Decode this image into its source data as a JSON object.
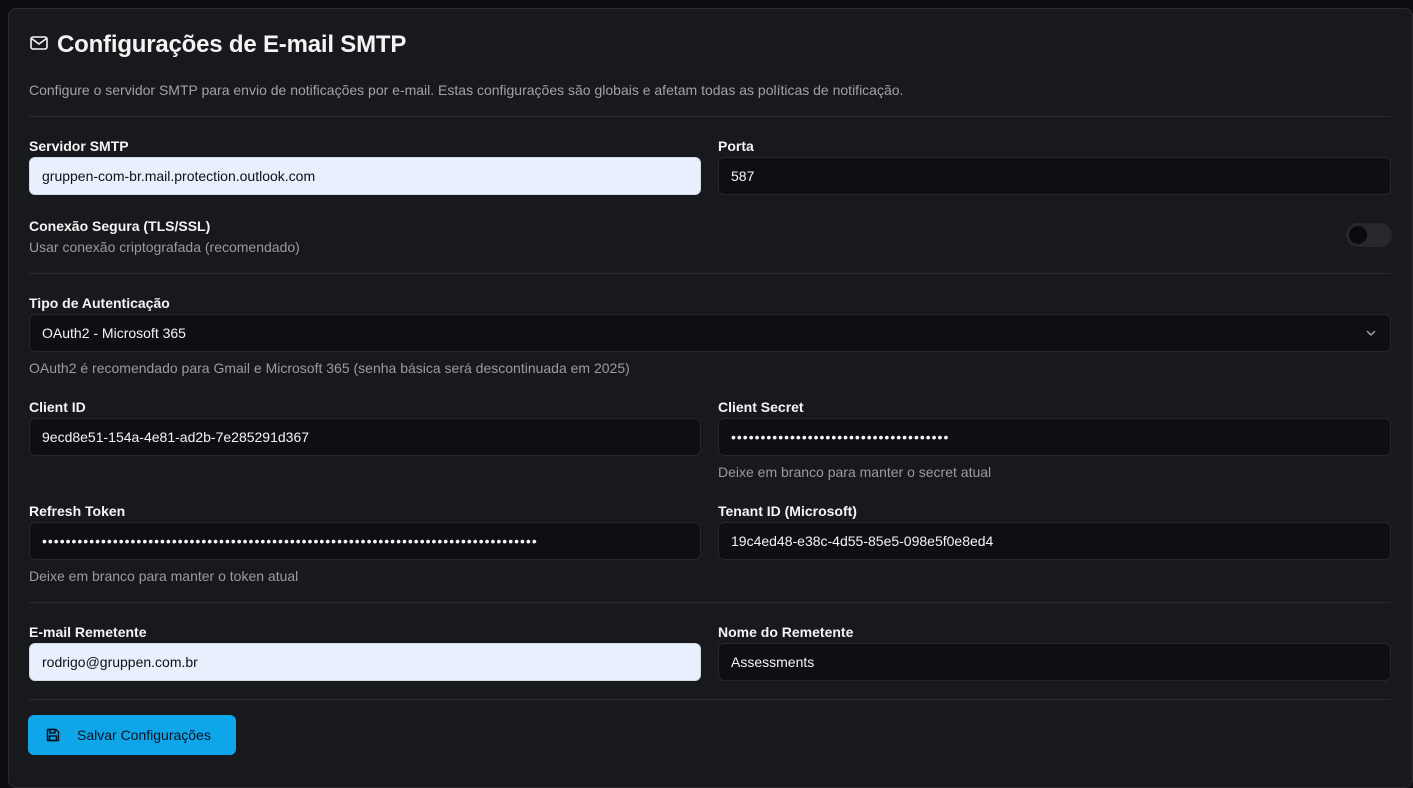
{
  "header": {
    "title": "Configurações de E-mail SMTP",
    "description": "Configure o servidor SMTP para envio de notificações por e-mail. Estas configurações são globais e afetam todas as políticas de notificação."
  },
  "smtp_server": {
    "label": "Servidor SMTP",
    "value": "gruppen-com-br.mail.protection.outlook.com"
  },
  "port": {
    "label": "Porta",
    "value": "587"
  },
  "secure": {
    "label": "Conexão Segura (TLS/SSL)",
    "help": "Usar conexão criptografada (recomendado)",
    "enabled": false
  },
  "auth": {
    "label": "Tipo de Autenticação",
    "value": "OAuth2 - Microsoft 365",
    "help": "OAuth2 é recomendado para Gmail e Microsoft 365 (senha básica será descontinuada em 2025)"
  },
  "client_id": {
    "label": "Client ID",
    "value": "9ecd8e51-154a-4e81-ad2b-7e285291d367"
  },
  "client_secret": {
    "label": "Client Secret",
    "value": "•••••••••••••••••••••••••••••••••••••",
    "help": "Deixe em branco para manter o secret atual"
  },
  "refresh_token": {
    "label": "Refresh Token",
    "value": "••••••••••••••••••••••••••••••••••••••••••••••••••••••••••••••••••••••••••••••••••••",
    "help": "Deixe em branco para manter o token atual"
  },
  "tenant_id": {
    "label": "Tenant ID (Microsoft)",
    "value": "19c4ed48-e38c-4d55-85e5-098e5f0e8ed4"
  },
  "sender_email": {
    "label": "E-mail Remetente",
    "value": "rodrigo@gruppen.com.br"
  },
  "sender_name": {
    "label": "Nome do Remetente",
    "value": "Assessments"
  },
  "save_button": {
    "label": "Salvar Configurações"
  },
  "icons": {
    "title": "mail-icon",
    "select": "chevron-down-icon",
    "save": "save-icon"
  },
  "colors": {
    "accent": "#0ea5e9",
    "background": "#18191d",
    "autofill": "#e8f0fe"
  }
}
